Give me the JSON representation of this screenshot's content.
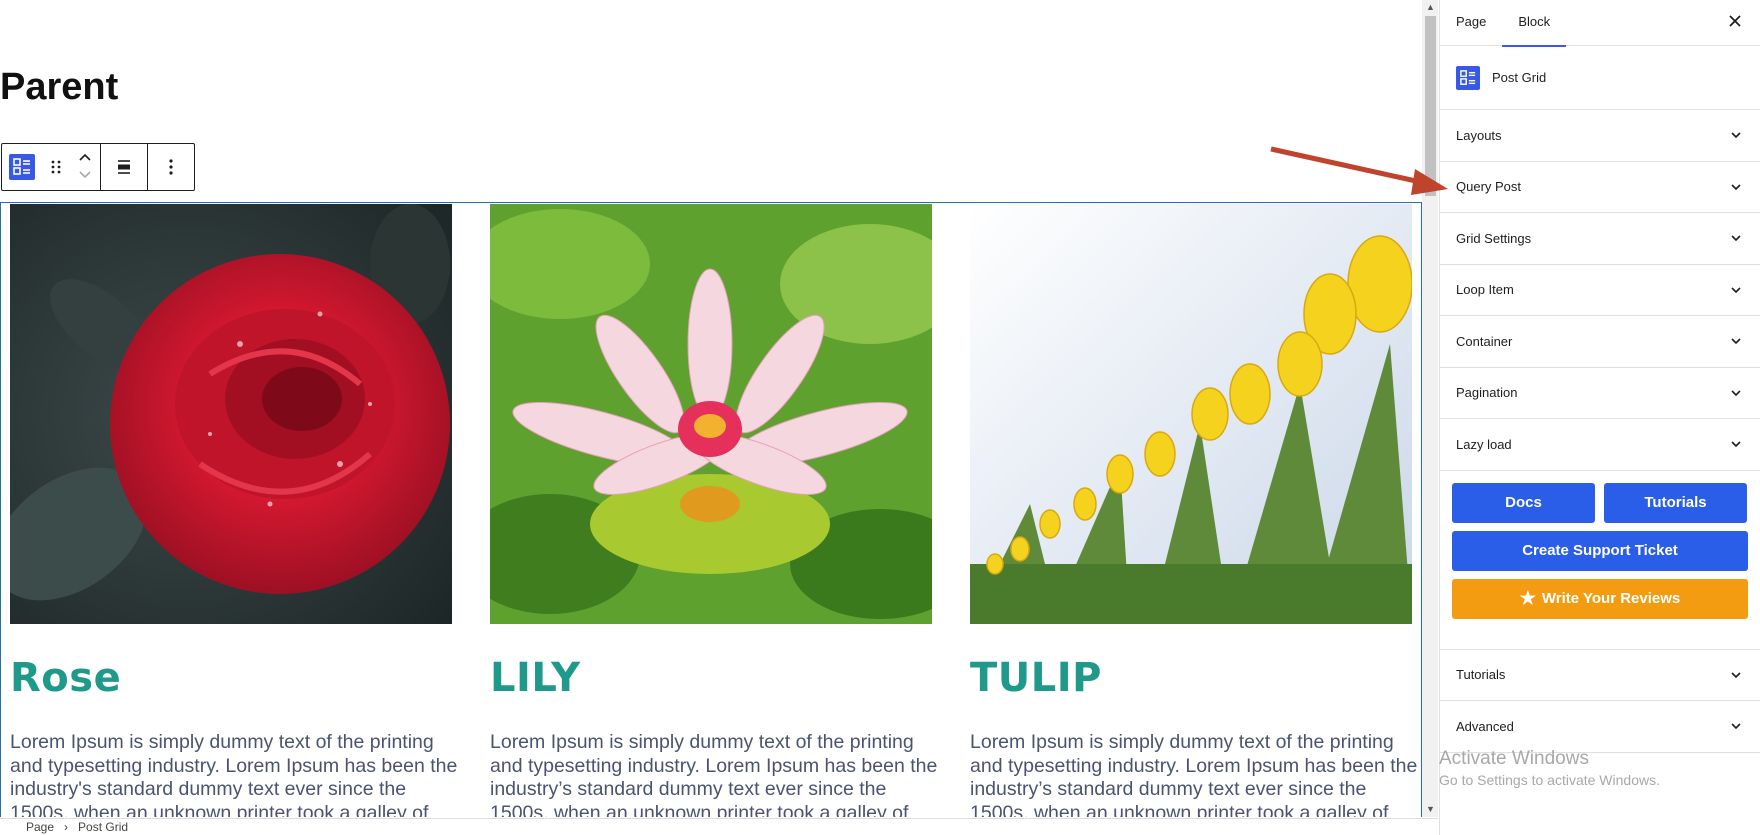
{
  "editor": {
    "page_title": "Parent",
    "posts": [
      {
        "title": "Rose",
        "excerpt": "Lorem Ipsum is simply dummy text of the printing and typesetting industry. Lorem Ipsum has been the industry's standard dummy text ever since the 1500s, when an unknown printer took a galley of"
      },
      {
        "title": "LILY",
        "excerpt": "Lorem Ipsum is simply dummy text of the printing and typesetting industry. Lorem Ipsum has been the industry’s standard dummy text ever since the 1500s, when an unknown printer took a galley of"
      },
      {
        "title": "TULIP",
        "excerpt": "Lorem Ipsum is simply dummy text of the printing and typesetting industry. Lorem Ipsum has been the industry’s standard dummy text ever since the 1500s, when an unknown printer took a galley of"
      }
    ]
  },
  "breadcrumb": [
    "Page",
    "Post Grid"
  ],
  "sidebar": {
    "tabs": [
      "Page",
      "Block"
    ],
    "active_tab": "Block",
    "block_name": "Post Grid",
    "panels": [
      "Layouts",
      "Query Post",
      "Grid Settings",
      "Loop Item",
      "Container",
      "Pagination",
      "Lazy load"
    ],
    "help": {
      "docs": "Docs",
      "tutorials": "Tutorials",
      "support": "Create Support Ticket",
      "reviews": "Write Your Reviews"
    },
    "bottom_panels": [
      "Tutorials",
      "Advanced"
    ]
  },
  "watermark": {
    "line1": "Activate Windows",
    "line2": "Go to Settings to activate Windows."
  },
  "colors": {
    "accent": "#3858e9",
    "title_teal": "#1f9a8a",
    "button_blue": "#2b5ee8",
    "button_orange": "#f39c12",
    "arrow": "#c0432b"
  },
  "icons": {
    "block": "post-grid-icon",
    "drag": "drag-handle-icon",
    "move_up": "chevron-up-icon",
    "move_down": "chevron-down-icon",
    "align": "align-icon",
    "more": "more-vertical-icon",
    "close": "close-icon",
    "review": "star-icon"
  }
}
